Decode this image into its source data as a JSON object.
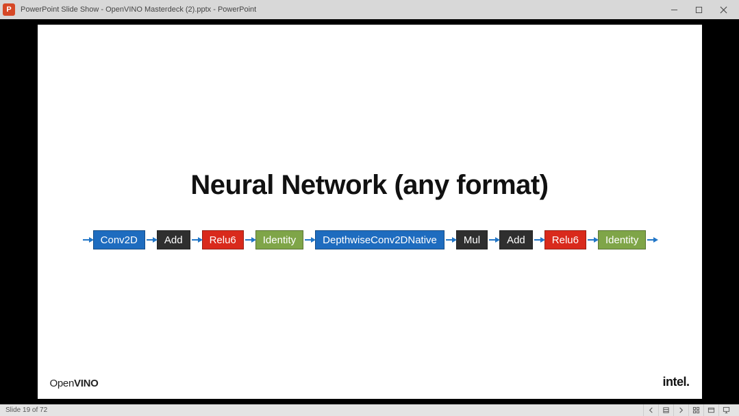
{
  "window": {
    "app_letter": "P",
    "title": "PowerPoint Slide Show  -  OpenVINO Masterdeck (2).pptx - PowerPoint"
  },
  "slide": {
    "title": "Neural Network (any format)",
    "nodes": [
      {
        "label": "Conv2D",
        "color": "blue"
      },
      {
        "label": "Add",
        "color": "black"
      },
      {
        "label": "Relu6",
        "color": "red"
      },
      {
        "label": "Identity",
        "color": "green"
      },
      {
        "label": "DepthwiseConv2DNative",
        "color": "blue"
      },
      {
        "label": "Mul",
        "color": "black"
      },
      {
        "label": "Add",
        "color": "black"
      },
      {
        "label": "Relu6",
        "color": "red"
      },
      {
        "label": "Identity",
        "color": "green"
      }
    ],
    "logo_left": "OpenVINO",
    "logo_right": "intel."
  },
  "status": {
    "slide_counter": "Slide 19 of 72"
  }
}
